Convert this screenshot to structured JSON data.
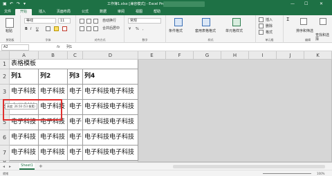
{
  "window": {
    "title": "工作簿1.xlsx [兼容模式] - Excel Preview",
    "autosave_label": "自动保存",
    "search_placeholder": "搜索"
  },
  "ribbon_tabs": [
    "文件",
    "开始",
    "插入",
    "页面布局",
    "公式",
    "数据",
    "审阅",
    "视图",
    "帮助"
  ],
  "ribbon": {
    "paste_label": "粘贴",
    "clipboard_label": "剪贴板",
    "font_name": "等线",
    "font_size": "11",
    "font_label": "字体",
    "align_label": "对齐方式",
    "wrap_label": "自动换行",
    "merge_label": "合并后居中",
    "number_format": "常规",
    "number_label": "数字",
    "cond_format_label": "条件格式",
    "table_format_label": "套用表格格式",
    "cell_style_label": "单元格样式",
    "styles_label": "样式",
    "insert_label": "插入",
    "delete_label": "删除",
    "format_label": "格式",
    "cells_label": "单元格",
    "sort_label": "排序和筛选",
    "find_label": "查找和选择",
    "editing_label": "编辑"
  },
  "formula_bar": {
    "name_box": "A2",
    "fx": "fx",
    "content": "列1"
  },
  "grid": {
    "columns": [
      "A",
      "B",
      "C",
      "D",
      "E",
      "F",
      "G",
      "H",
      "I",
      "J",
      "K"
    ],
    "rows": [
      "1",
      "2",
      "3",
      "4",
      "5",
      "6",
      "7",
      "8"
    ],
    "title_cell": "表格模板",
    "headers": [
      "列1",
      "列2",
      "列3",
      "列4"
    ],
    "data_rows": [
      [
        "电子科技",
        "电子科技",
        "电子",
        "电子科技电子科技"
      ],
      [
        "电子科技",
        "电子科技",
        "电子",
        "电子科技电子科技"
      ],
      [
        "电子科技",
        "电子科技",
        "电子",
        "电子科技电子科技"
      ],
      [
        "电子科技",
        "电子科技",
        "电子",
        "电子科技电子科技"
      ],
      [
        "电子科技",
        "电子科技",
        "电子",
        "电子科技电子科技"
      ]
    ],
    "tooltip": "高度: 26.50 (53 像素)"
  },
  "sheets": {
    "active": "Sheet1",
    "add": "+"
  },
  "status": {
    "mode": "就绪",
    "zoom": "100%"
  }
}
